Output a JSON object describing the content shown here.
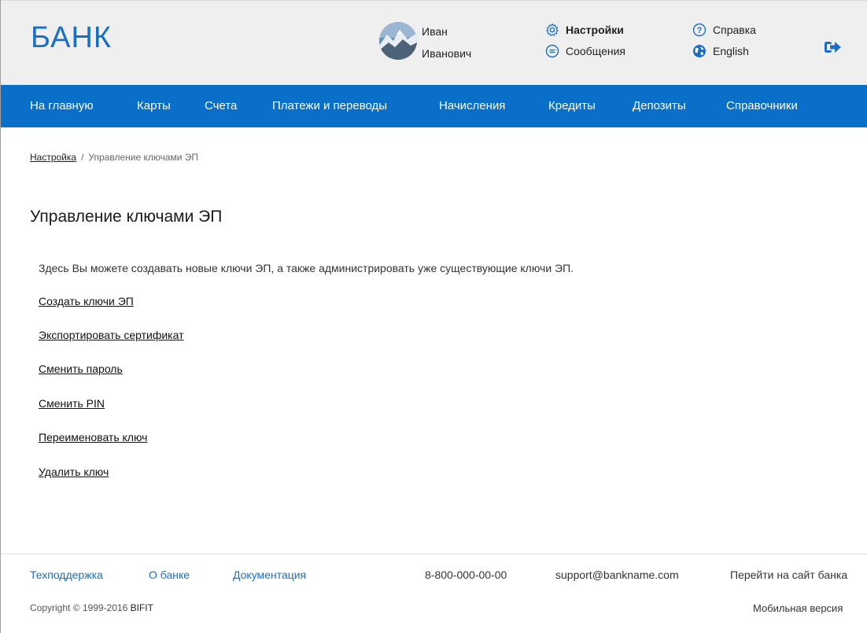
{
  "header": {
    "logo": "БАНК",
    "user": {
      "first_name": "Иван",
      "last_name": "Иванович"
    },
    "links": {
      "settings": "Настройки",
      "messages": "Сообщения",
      "help": "Справка",
      "language": "English"
    }
  },
  "nav": {
    "items": [
      "На главную",
      "Карты",
      "Счета",
      "Платежи и переводы",
      "Начисления",
      "Кредиты",
      "Депозиты",
      "Справочники"
    ]
  },
  "breadcrumb": {
    "parent": "Настройка",
    "separator": "/",
    "current": "Управление ключами ЭП"
  },
  "main": {
    "title": "Управление ключами ЭП",
    "description": "Здесь Вы можете создавать новые ключи ЭП, а также администрировать уже существующие ключи ЭП.",
    "actions": [
      "Создать ключи ЭП",
      "Экспортировать сертификат",
      "Сменить пароль",
      "Сменить PIN",
      "Переименовать ключ",
      "Удалить ключ"
    ]
  },
  "footer": {
    "links": [
      "Техподдержка",
      "О банке",
      "Документация"
    ],
    "phone": "8-800-000-00-00",
    "email": "support@bankname.com",
    "site_link": "Перейти на сайт банка",
    "copyright_prefix": "Copyright © 1999-2016",
    "copyright_company": "BIFIT",
    "mobile": "Мобильная версия"
  },
  "colors": {
    "brand_blue": "#0a6fc9",
    "link_blue": "#1a6fc4",
    "header_bg": "#efefef"
  },
  "icons": [
    "gear-icon",
    "message-icon",
    "help-icon",
    "globe-icon",
    "logout-icon"
  ]
}
